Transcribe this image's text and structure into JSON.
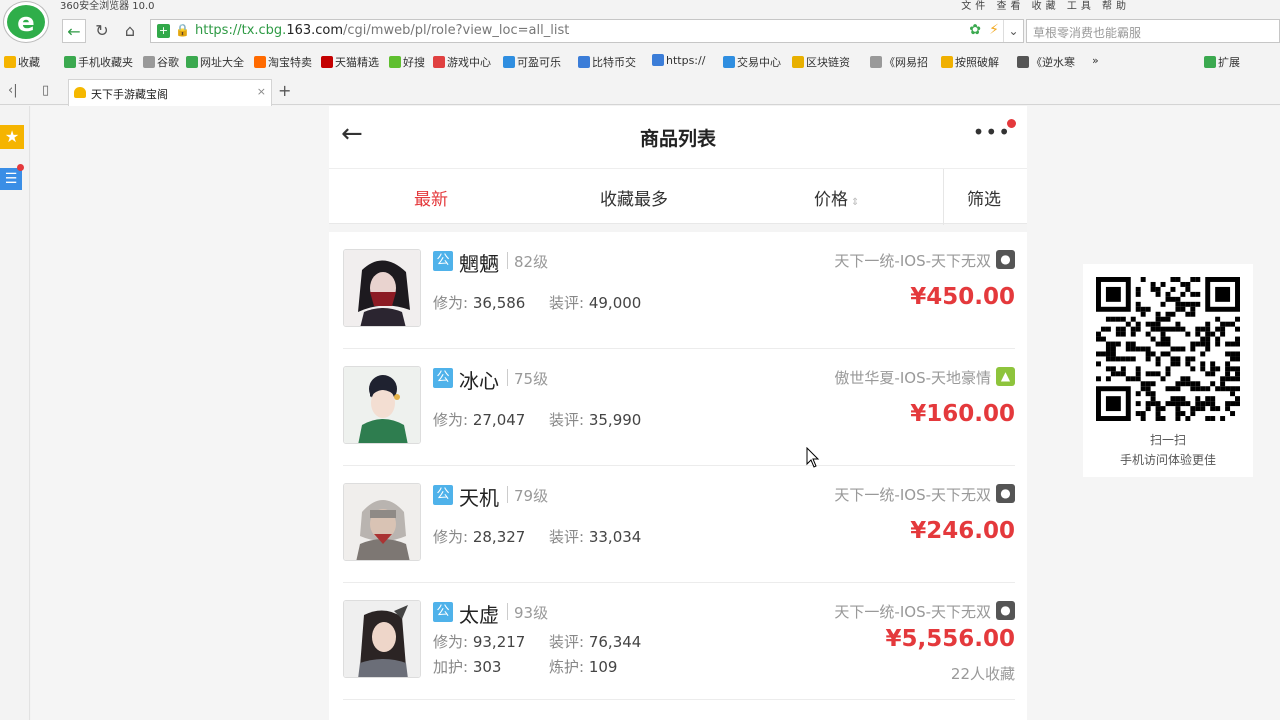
{
  "browser": {
    "app_title": "360安全浏览器 10.0",
    "window_menu": "文件 查看 收藏 工具 帮助",
    "logo": "e",
    "url_scheme_host": "https://tx.cbg.",
    "url_domain": "163.com",
    "url_path": "/cgi/mweb/pl/role?view_loc=all_list",
    "search_placeholder": "草根零消费也能霸服",
    "bookmarks": [
      {
        "label": "收藏",
        "icon": "star-icon",
        "color": "#f5b400"
      },
      {
        "label": "手机收藏夹",
        "icon": "phone-icon",
        "color": "#3ba94f"
      },
      {
        "label": "谷歌",
        "icon": "page-icon",
        "color": "#999999"
      },
      {
        "label": "网址大全",
        "icon": "globe-icon",
        "color": "#3ba94f"
      },
      {
        "label": "淘宝特卖",
        "icon": "taobao-icon",
        "color": "#ff6a00"
      },
      {
        "label": "天猫精选",
        "icon": "tmall-icon",
        "color": "#c40000"
      },
      {
        "label": "好搜",
        "icon": "haosou-icon",
        "color": "#5fbf2f"
      },
      {
        "label": "游戏中心",
        "icon": "game-icon",
        "color": "#e04040"
      },
      {
        "label": "可盈可乐",
        "icon": "coin-icon",
        "color": "#2f8ee0"
      },
      {
        "label": "比特币交",
        "icon": "drop-icon",
        "color": "#3b7dd8"
      },
      {
        "label": "https://",
        "icon": "b-icon",
        "color": "#3b7dd8"
      },
      {
        "label": "交易中心",
        "icon": "trade-icon",
        "color": "#2f8ee0"
      },
      {
        "label": "区块链资",
        "icon": "block-icon",
        "color": "#e8b000"
      },
      {
        "label": "《网易招",
        "icon": "page-icon",
        "color": "#999999"
      },
      {
        "label": "按照破解",
        "icon": "hand-icon",
        "color": "#f0b000"
      },
      {
        "label": "《逆水寒",
        "icon": "figure-icon",
        "color": "#555555"
      }
    ],
    "bookmarks_more": "»",
    "extensions_label": "扩展",
    "tab_title": "天下手游藏宝阁",
    "tab_close": "×",
    "new_tab": "+"
  },
  "page": {
    "title": "商品列表",
    "back_glyph": "←",
    "more_glyph": "•••",
    "sort": {
      "newest": "最新",
      "most_fav": "收藏最多",
      "price": "价格",
      "filter": "筛选"
    },
    "public_badge": "公",
    "items": [
      {
        "name": "魍魉",
        "level": "82级",
        "xiuwei_label": "修为:",
        "xiuwei": "36,586",
        "zhuangping_label": "装评:",
        "zhuangping": "49,000",
        "server": "天下一统-IOS-天下无双",
        "os": "ios",
        "price": "¥450.00"
      },
      {
        "name": "冰心",
        "level": "75级",
        "xiuwei_label": "修为:",
        "xiuwei": "27,047",
        "zhuangping_label": "装评:",
        "zhuangping": "35,990",
        "server": "傲世华夏-IOS-天地豪情",
        "os": "android",
        "price": "¥160.00"
      },
      {
        "name": "天机",
        "level": "79级",
        "xiuwei_label": "修为:",
        "xiuwei": "28,327",
        "zhuangping_label": "装评:",
        "zhuangping": "33,034",
        "server": "天下一统-IOS-天下无双",
        "os": "ios",
        "price": "¥246.00"
      },
      {
        "name": "太虚",
        "level": "93级",
        "xiuwei_label": "修为:",
        "xiuwei": "93,217",
        "zhuangping_label": "装评:",
        "zhuangping": "76,344",
        "jiahu_label": "加护:",
        "jiahu": "303",
        "lianhu_label": "炼护:",
        "lianhu": "109",
        "server": "天下一统-IOS-天下无双",
        "os": "ios",
        "price": "¥5,556.00",
        "fav_count": "22人收藏"
      }
    ]
  },
  "qr_panel": {
    "line1": "扫一扫",
    "line2": "手机访问体验更佳"
  },
  "colors": {
    "accent_red": "#e4393c",
    "badge_blue": "#4fb2ea",
    "browser_green": "#2e9a44"
  }
}
